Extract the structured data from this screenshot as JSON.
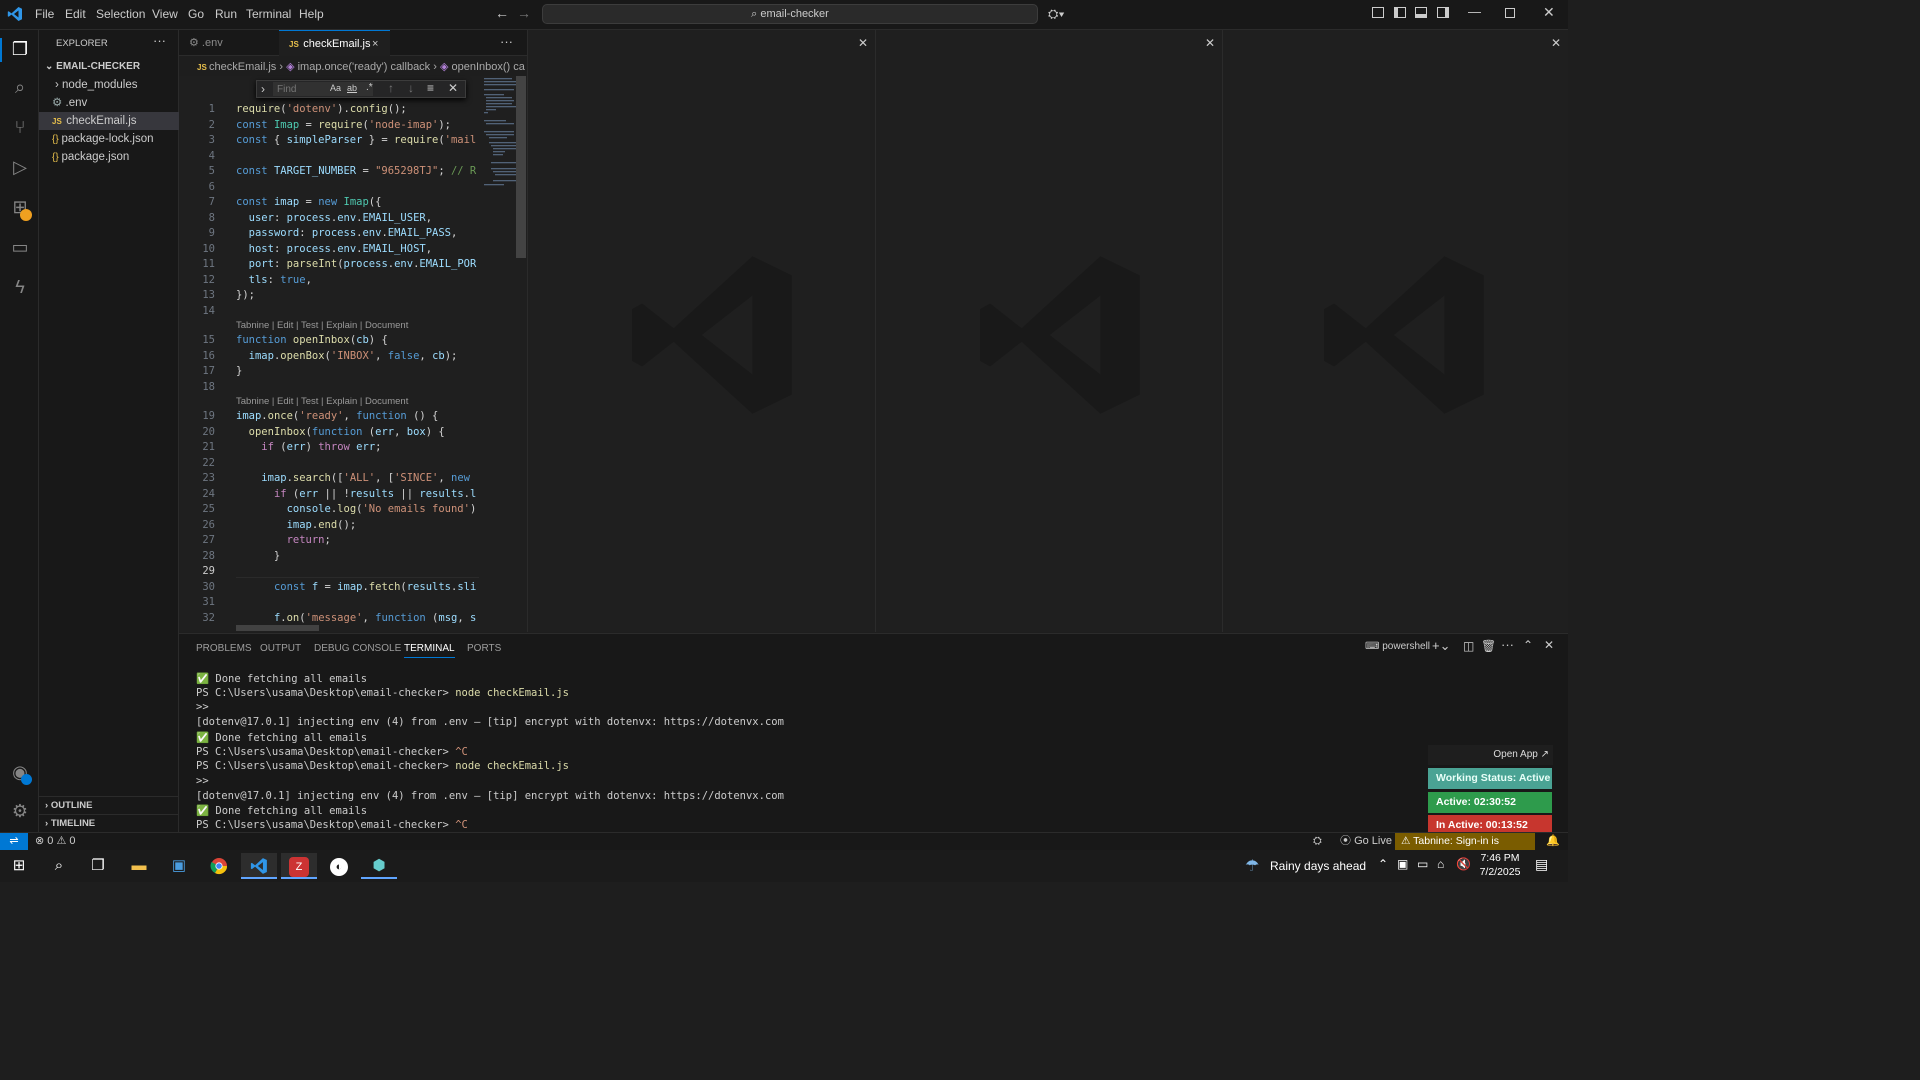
{
  "menu": [
    "File",
    "Edit",
    "Selection",
    "View",
    "Go",
    "Run",
    "Terminal",
    "Help"
  ],
  "search": {
    "text": "email-checker"
  },
  "sidebar": {
    "title": "EXPLORER",
    "project": "EMAIL-CHECKER",
    "items": [
      {
        "label": "node_modules",
        "icon": "chevron-right-icon"
      },
      {
        "label": ".env",
        "icon": "gear-icon"
      },
      {
        "label": "checkEmail.js",
        "icon": "js-icon"
      },
      {
        "label": "package-lock.json",
        "icon": "json-icon"
      },
      {
        "label": "package.json",
        "icon": "json-icon"
      }
    ],
    "outline": "OUTLINE",
    "timeline": "TIMELINE"
  },
  "tabs": [
    {
      "label": ".env"
    },
    {
      "label": "checkEmail.js"
    }
  ],
  "breadcrumb": {
    "file": "checkEmail.js",
    "scope1": "imap.once('ready') callback",
    "scope2": "openInbox() ca"
  },
  "find": {
    "placeholder": "Find",
    "opt_case": "Aa",
    "opt_word": "ab",
    "opt_regex": ".*"
  },
  "editor": {
    "lines": [
      {
        "n": "1",
        "t": "require('dotenv').config();"
      },
      {
        "n": "2",
        "t": "const Imap = require('node-imap');"
      },
      {
        "n": "3",
        "t": "const { simpleParser } = require('mail"
      },
      {
        "n": "4",
        "t": ""
      },
      {
        "n": "5",
        "t": "const TARGET_NUMBER = \"965298TJ\"; // R"
      },
      {
        "n": "6",
        "t": ""
      },
      {
        "n": "7",
        "t": "const imap = new Imap({"
      },
      {
        "n": "8",
        "t": "  user: process.env.EMAIL_USER,"
      },
      {
        "n": "9",
        "t": "  password: process.env.EMAIL_PASS,"
      },
      {
        "n": "10",
        "t": "  host: process.env.EMAIL_HOST,"
      },
      {
        "n": "11",
        "t": "  port: parseInt(process.env.EMAIL_POR"
      },
      {
        "n": "12",
        "t": "  tls: true,"
      },
      {
        "n": "13",
        "t": "});"
      },
      {
        "n": "14",
        "t": ""
      },
      {
        "n": "15",
        "t": "function openInbox(cb) {"
      },
      {
        "n": "16",
        "t": "  imap.openBox('INBOX', false, cb);"
      },
      {
        "n": "17",
        "t": "}"
      },
      {
        "n": "18",
        "t": ""
      },
      {
        "n": "19",
        "t": "imap.once('ready', function () {"
      },
      {
        "n": "20",
        "t": "  openInbox(function (err, box) {"
      },
      {
        "n": "21",
        "t": "    if (err) throw err;"
      },
      {
        "n": "22",
        "t": ""
      },
      {
        "n": "23",
        "t": "    imap.search(['ALL', ['SINCE', new"
      },
      {
        "n": "24",
        "t": "      if (err || !results || results.l"
      },
      {
        "n": "25",
        "t": "        console.log('No emails found')"
      },
      {
        "n": "26",
        "t": "        imap.end();"
      },
      {
        "n": "27",
        "t": "        return;"
      },
      {
        "n": "28",
        "t": "      }"
      },
      {
        "n": "29",
        "t": ""
      },
      {
        "n": "30",
        "t": "      const f = imap.fetch(results.sli"
      },
      {
        "n": "31",
        "t": ""
      },
      {
        "n": "32",
        "t": "      f.on('message', function (msg, s"
      }
    ],
    "codelens": "Tabnine | Edit | Test | Explain | Document"
  },
  "panel": {
    "tabs": [
      "PROBLEMS",
      "OUTPUT",
      "DEBUG CONSOLE",
      "TERMINAL",
      "PORTS"
    ],
    "active_tab": "TERMINAL",
    "shell": "powershell",
    "terminal_lines": [
      "✅ Done fetching all emails",
      "PS C:\\Users\\usama\\Desktop\\email-checker> node checkEmail.js",
      ">>",
      "[dotenv@17.0.1] injecting env (4) from .env – [tip] encrypt with dotenvx: https://dotenvx.com",
      "✅ Done fetching all emails",
      "PS C:\\Users\\usama\\Desktop\\email-checker> ^C",
      "PS C:\\Users\\usama\\Desktop\\email-checker> node checkEmail.js",
      ">>",
      "[dotenv@17.0.1] injecting env (4) from .env – [tip] encrypt with dotenvx: https://dotenvx.com",
      "✅ Done fetching all emails",
      "PS C:\\Users\\usama\\Desktop\\email-checker> ^C"
    ]
  },
  "widget": {
    "open_app": "Open App ↗",
    "working": "Working Status: Active",
    "active": "Active: 02:30:52",
    "inactive": "In Active: 00:13:52"
  },
  "status": {
    "errors": "0",
    "warnings": "0",
    "go_live": "Go Live",
    "tabnine": "Tabnine: Sign-in is required"
  },
  "taskbar": {
    "weather": "Rainy days ahead",
    "time": "7:46 PM",
    "date": "7/2/2025"
  },
  "colors": {
    "accent": "#0078d4",
    "working_bg": "#4aa394",
    "active_bg": "#2e9b4c",
    "inactive_bg": "#c7362e"
  }
}
